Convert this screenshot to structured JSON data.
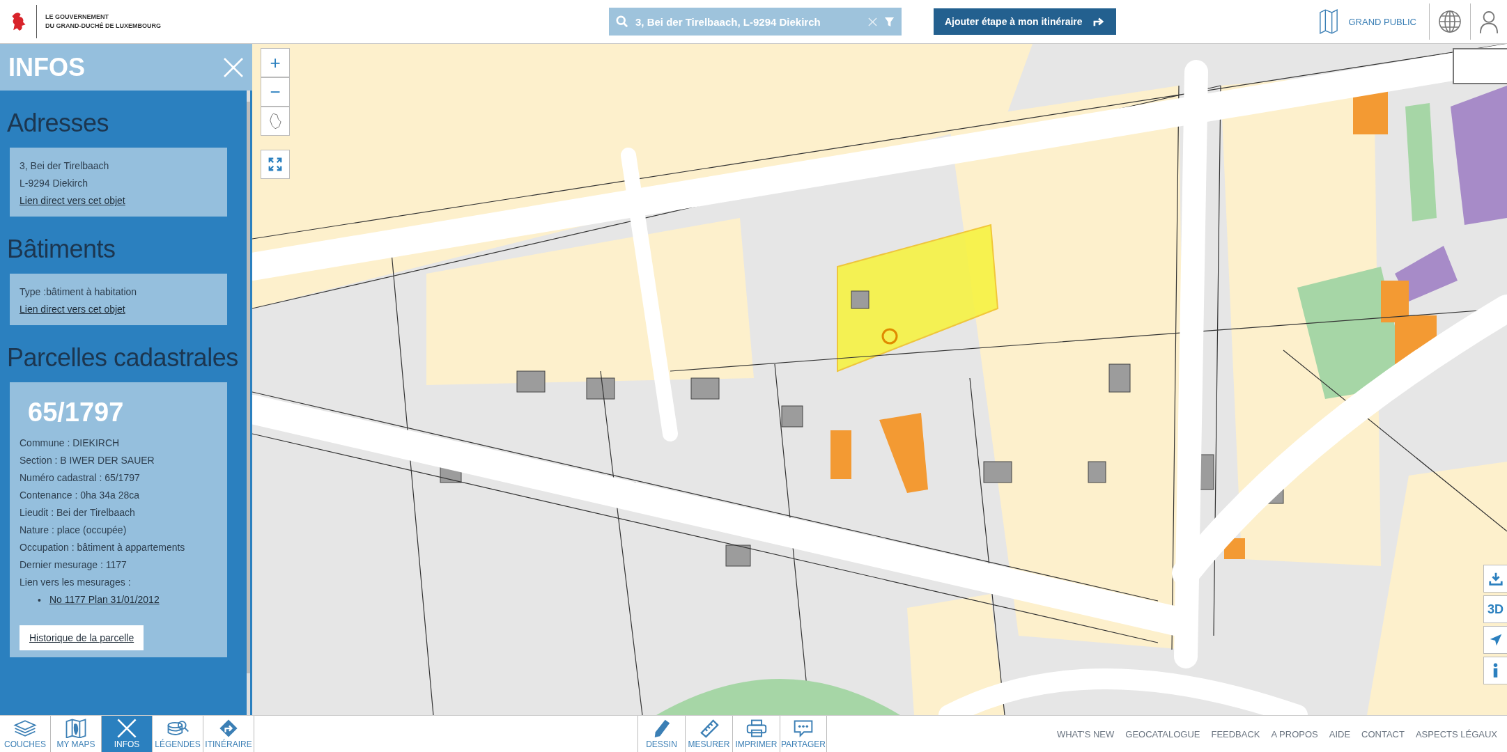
{
  "header": {
    "logo_lines": [
      "LE GOUVERNEMENT",
      "DU GRAND-DUCHÉ DE LUXEMBOURG"
    ],
    "search": {
      "value": "3, Bei der Tirelbaach, L-9294 Diekirch"
    },
    "route_button": "Ajouter étape à mon itinéraire",
    "profile": "GRAND PUBLIC"
  },
  "panel": {
    "title": "INFOS",
    "sections": [
      {
        "heading": "Adresses",
        "lines": [
          "3, Bei der Tirelbaach",
          "L-9294 Diekirch"
        ],
        "link": "Lien direct vers cet objet"
      },
      {
        "heading": "Bâtiments",
        "lines": [
          "Type :bâtiment à habitation"
        ],
        "link": "Lien direct vers cet objet"
      },
      {
        "heading": "Parcelles cadastrales",
        "parcel": "65/1797",
        "lines": [
          "Commune : DIEKIRCH",
          "Section : B IWER DER SAUER",
          "Numéro cadastral : 65/1797",
          "Contenance : 0ha 34a 28ca",
          "Lieudit : Bei der Tirelbaach",
          "Nature : place (occupée)",
          "Occupation : bâtiment à appartements",
          "Dernier mesurage : 1177",
          "Lien vers les mesurages :"
        ],
        "measure_links": [
          {
            "bullet": "•",
            "text": "No 1177 Plan 31/01/2012"
          }
        ],
        "button": "Historique de la parcelle"
      }
    ]
  },
  "map": {
    "zoom_controls": [
      "+",
      "−"
    ],
    "side_buttons": [
      {
        "kind": "download"
      },
      {
        "kind": "text",
        "label": "3D"
      },
      {
        "kind": "locate"
      },
      {
        "kind": "info"
      }
    ]
  },
  "tabs": [
    {
      "label": "COUCHES",
      "kind": "layers",
      "selected": false
    },
    {
      "label": "MY MAPS",
      "kind": "mymaps",
      "selected": false
    },
    {
      "label": "INFOS",
      "kind": "close",
      "selected": true
    },
    {
      "label": "LÉGENDES",
      "kind": "legend",
      "selected": false
    },
    {
      "label": "ITINÉRAIRE",
      "kind": "route",
      "selected": false
    }
  ],
  "tools": [
    {
      "label": "DESSIN",
      "kind": "pencil"
    },
    {
      "label": "MESURER",
      "kind": "ruler"
    },
    {
      "label": "IMPRIMER",
      "kind": "printer"
    },
    {
      "label": "PARTAGER",
      "kind": "share"
    }
  ],
  "footer_links": [
    "WHAT'S NEW",
    "GEOCATALOGUE",
    "FEEDBACK",
    "A PROPOS",
    "AIDE",
    "CONTACT",
    "ASPECTS LÉGAUX"
  ]
}
